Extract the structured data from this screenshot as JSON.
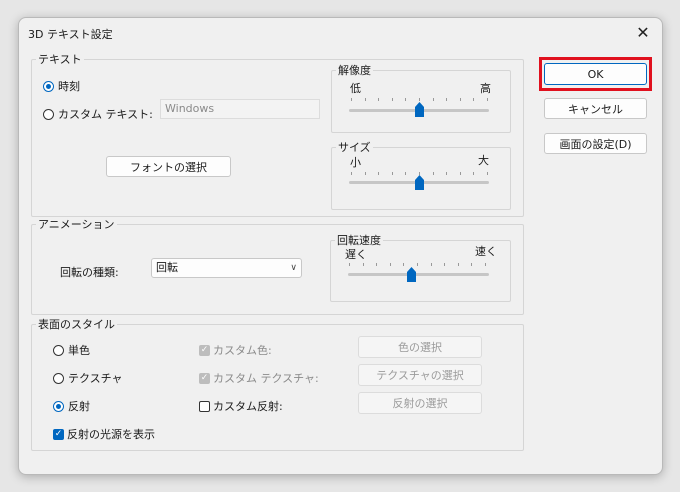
{
  "window": {
    "title": "3D テキスト設定"
  },
  "text_group": {
    "legend": "テキスト",
    "time_radio": "時刻",
    "custom_text_radio": "カスタム テキスト:",
    "custom_text_value": "Windows",
    "font_button": "フォントの選択",
    "resolution": {
      "legend": "解像度",
      "low": "低",
      "high": "高",
      "value_percent": 50
    },
    "size": {
      "legend": "サイズ",
      "small": "小",
      "large": "大",
      "value_percent": 50
    }
  },
  "animation_group": {
    "legend": "アニメーション",
    "rotation_type_label": "回転の種類:",
    "rotation_type_value": "回転",
    "rotation_speed": {
      "legend": "回転速度",
      "slow": "遅く",
      "fast": "速く",
      "value_percent": 45
    }
  },
  "surface_group": {
    "legend": "表面のスタイル",
    "solid_radio": "単色",
    "texture_radio": "テクスチャ",
    "reflection_radio": "反射",
    "custom_color_check": "カスタム色:",
    "custom_texture_check": "カスタム テクスチャ:",
    "custom_reflection_check": "カスタム反射:",
    "color_select_button": "色の選択",
    "texture_select_button": "テクスチャの選択",
    "reflection_select_button": "反射の選択",
    "show_reflection_light_check": "反射の光源を表示"
  },
  "buttons": {
    "ok": "OK",
    "cancel": "キャンセル",
    "screen_settings": "画面の設定(D)"
  },
  "colors": {
    "accent": "#0067c0",
    "highlight": "#e0101e"
  }
}
